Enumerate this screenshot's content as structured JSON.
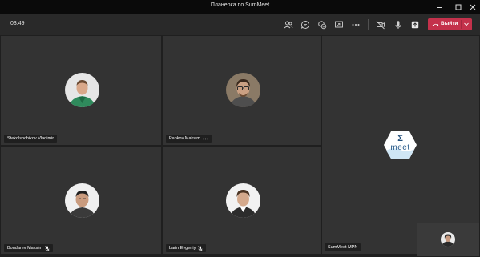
{
  "window": {
    "title": "Планерка по SumMeet",
    "buttons": [
      "minimize",
      "maximize",
      "close"
    ]
  },
  "toolbar": {
    "timer": "03:49",
    "icons": [
      "participants-icon",
      "chat-icon",
      "reactions-icon",
      "share-screen-icon",
      "more-icon",
      "camera-icon",
      "microphone-icon",
      "share-content-icon"
    ],
    "leave_label": "Выйти",
    "leave_color": "#c4314b"
  },
  "participants": [
    {
      "name": "Stekolshchikov Vladimir",
      "muted": false,
      "more": false
    },
    {
      "name": "Pankov Maksim",
      "muted": false,
      "more": true
    },
    {
      "name": "Bondarev Maksim",
      "muted": true,
      "more": false
    },
    {
      "name": "Larin Evgeniy",
      "muted": true,
      "more": false
    }
  ],
  "spotlight": {
    "name": "SumMeet MPN",
    "logo_symbol": "Σ",
    "logo_text": "meet"
  }
}
